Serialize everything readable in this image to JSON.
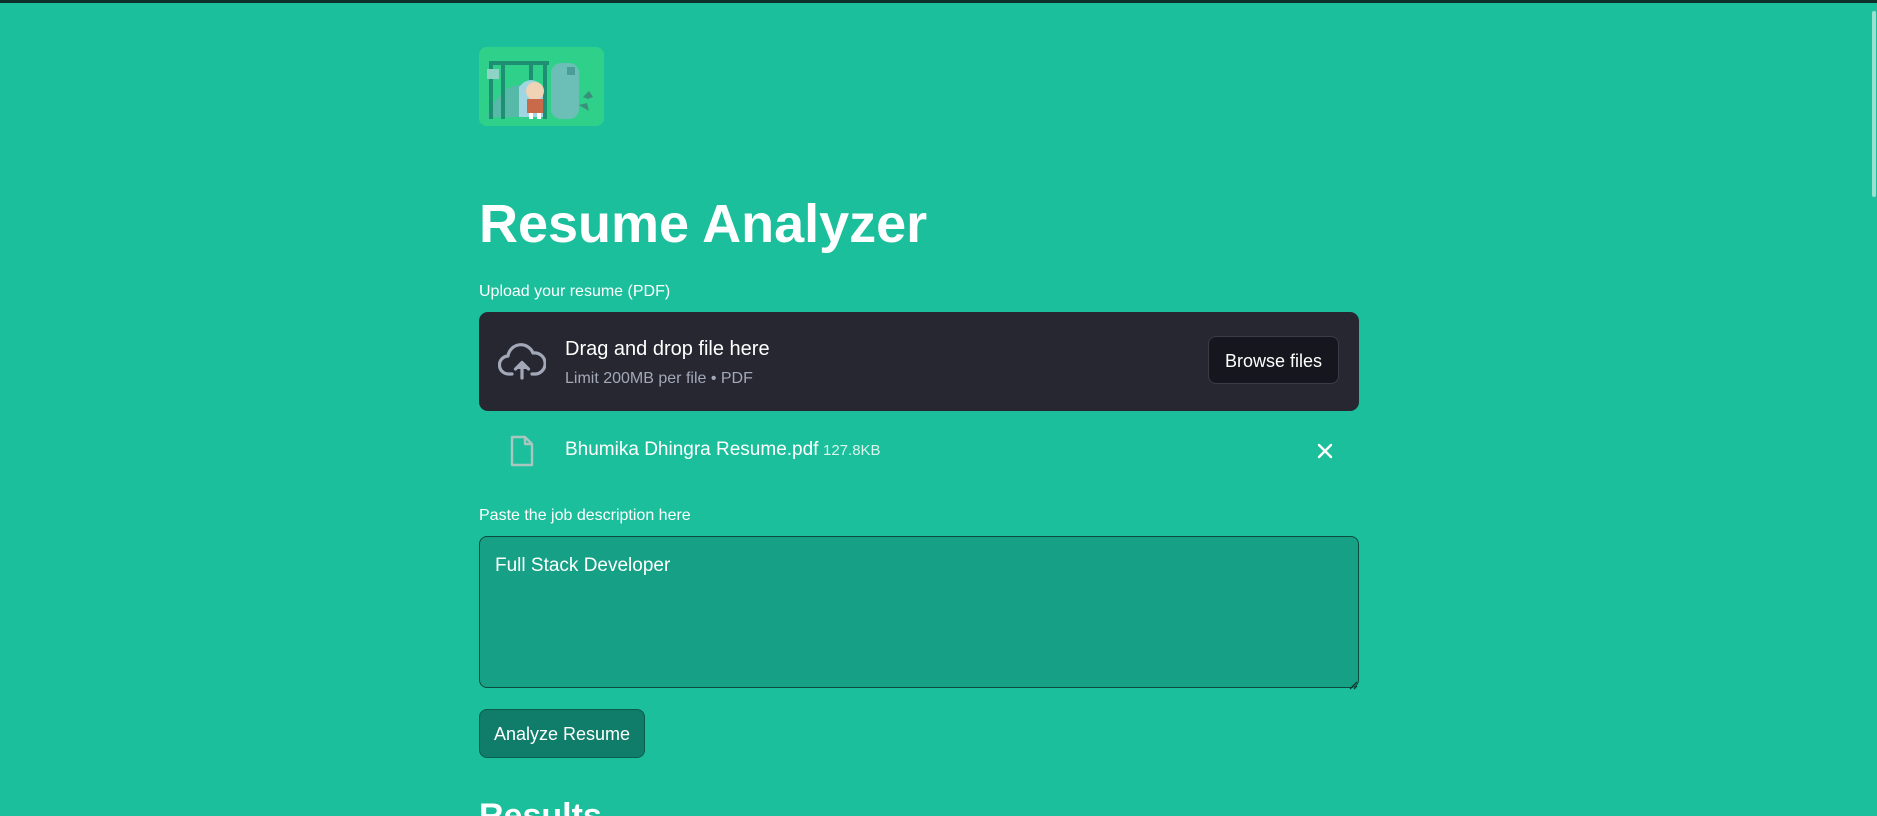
{
  "app": {
    "title": "Resume Analyzer"
  },
  "logo": {
    "icon": "app-logo-illustration"
  },
  "upload": {
    "label": "Upload your resume (PDF)",
    "dropzone_title": "Drag and drop file here",
    "dropzone_hint": "Limit 200MB per file • PDF",
    "browse_label": "Browse files",
    "icon": "cloud-upload-icon"
  },
  "uploaded_file": {
    "name": "Bhumika Dhingra Resume.pdf",
    "size": "127.8KB",
    "icon": "file-icon",
    "remove_icon": "close-icon"
  },
  "job_description": {
    "label": "Paste the job description here",
    "value": "Full Stack Developer"
  },
  "actions": {
    "analyze_label": "Analyze Resume"
  },
  "results": {
    "heading": "Results"
  },
  "colors": {
    "background": "#1bbf9b",
    "dropzone": "#262730",
    "textarea": "#16a085",
    "analyze_button": "#0f7d69"
  }
}
